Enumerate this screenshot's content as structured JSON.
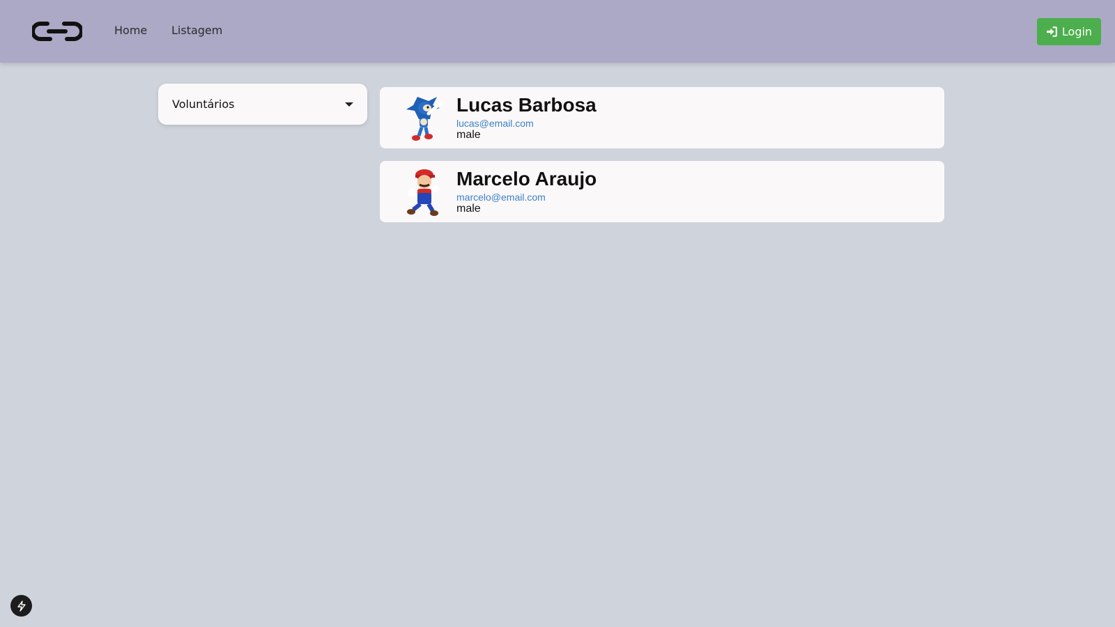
{
  "navbar": {
    "logo_icon": "chain-link-logo",
    "links": [
      {
        "label": "Home"
      },
      {
        "label": "Listagem"
      }
    ],
    "login_label": "Login",
    "login_icon": "sign-in-icon",
    "colors": {
      "background": "#aba9c6",
      "login": "#4cae4c"
    }
  },
  "filter": {
    "selected": "Voluntários",
    "icon": "caret-down-icon"
  },
  "volunteers": [
    {
      "name": "Lucas Barbosa",
      "email": "lucas@email.com",
      "gender": "male",
      "avatar": "sonic-avatar"
    },
    {
      "name": "Marcelo Araujo",
      "email": "marcelo@email.com",
      "gender": "male",
      "avatar": "mario-avatar"
    }
  ],
  "badge_icon": "lightning-bolt-icon"
}
